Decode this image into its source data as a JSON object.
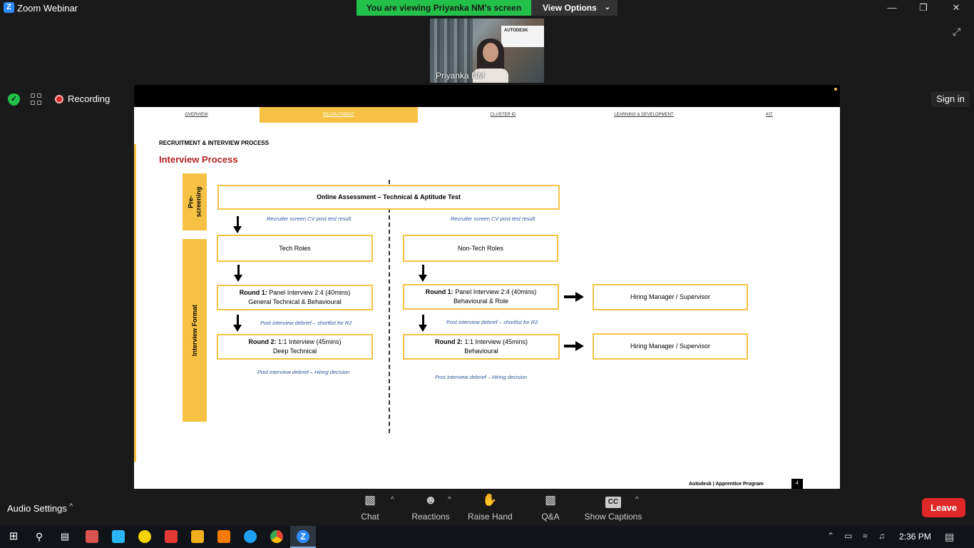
{
  "window": {
    "app_title": "Zoom Webinar",
    "logo_letter": "Z",
    "min": "—",
    "restore": "❐",
    "close": "✕"
  },
  "viewing": {
    "banner": "You are viewing Priyanka NM's screen",
    "view_options": "View Options",
    "chevron": "⌄"
  },
  "video": {
    "participant_name": "Priyanka NM",
    "brand_text": "AUTODESK"
  },
  "meeting_bar": {
    "recording_label": "Recording",
    "sign_in_label": "Sign in",
    "expand_icon": "⤢"
  },
  "slide": {
    "nav_tabs": [
      "OVERVIEW",
      "RECRUITMENT",
      "CLUSTER ID",
      "LEARNING & DEVELOPMENT",
      "KIT"
    ],
    "active_tab": "RECRUITMENT",
    "section_title": "RECRUITMENT & INTERVIEW PROCESS",
    "heading": "Interview Process",
    "side_labels": {
      "prescreening": "Pre-\nscreening",
      "interview_format": "Interview Format"
    },
    "online_assessment": "Online Assessment – Technical & Aptitude Test",
    "recruiter_note_left": "Recruiter screen CV post test result",
    "recruiter_note_right": "Recruiter screen CV post test result",
    "tech": {
      "title": "Tech Roles",
      "round1_bold": "Round 1:",
      "round1_text": " Panel Interview 2:4 (40mins)",
      "round1_line2": "General Technical & Behavioural",
      "note_after_r1": "Post interview debrief – shortlist for R2",
      "round2_bold": "Round 2:",
      "round2_text": " 1:1 Interview (45mins)",
      "round2_line2": "Deep Technical",
      "note_after_r2": "Post interview debrief – Hiring decision"
    },
    "nontech": {
      "title": "Non-Tech  Roles",
      "round1_bold": "Round 1:",
      "round1_text": " Panel Interview 2:4 (40mins)",
      "round1_line2": "Behavioural & Role",
      "note_after_r1": "Post interview debrief – shortlist for R2",
      "round2_bold": "Round 2:",
      "round2_text": " 1:1 Interview (45mins)",
      "round2_line2": "Behavioural",
      "note_after_r2": "Post interview debrief – Hiring decision"
    },
    "hiring_manager_1": "Hiring Manager / Supervisor",
    "hiring_manager_2": "Hiring Manager / Supervisor",
    "footer": "Autodesk   |   Apprentice Program",
    "page_number": "4"
  },
  "controls": {
    "audio_settings": "Audio Settings",
    "caret": "^",
    "chat": "Chat",
    "reactions": "Reactions",
    "raise_hand": "Raise Hand",
    "qa": "Q&A",
    "show_captions": "Show Captions",
    "cc": "CC",
    "leave": "Leave"
  },
  "taskbar": {
    "time": "2:36 PM"
  },
  "colors": {
    "accent_yellow": "#f7c244",
    "heading_red": "#b22222",
    "note_blue": "#2f5597",
    "zoom_blue": "#2d8cff",
    "leave_red": "#e02828",
    "banner_green": "#23c04a"
  }
}
